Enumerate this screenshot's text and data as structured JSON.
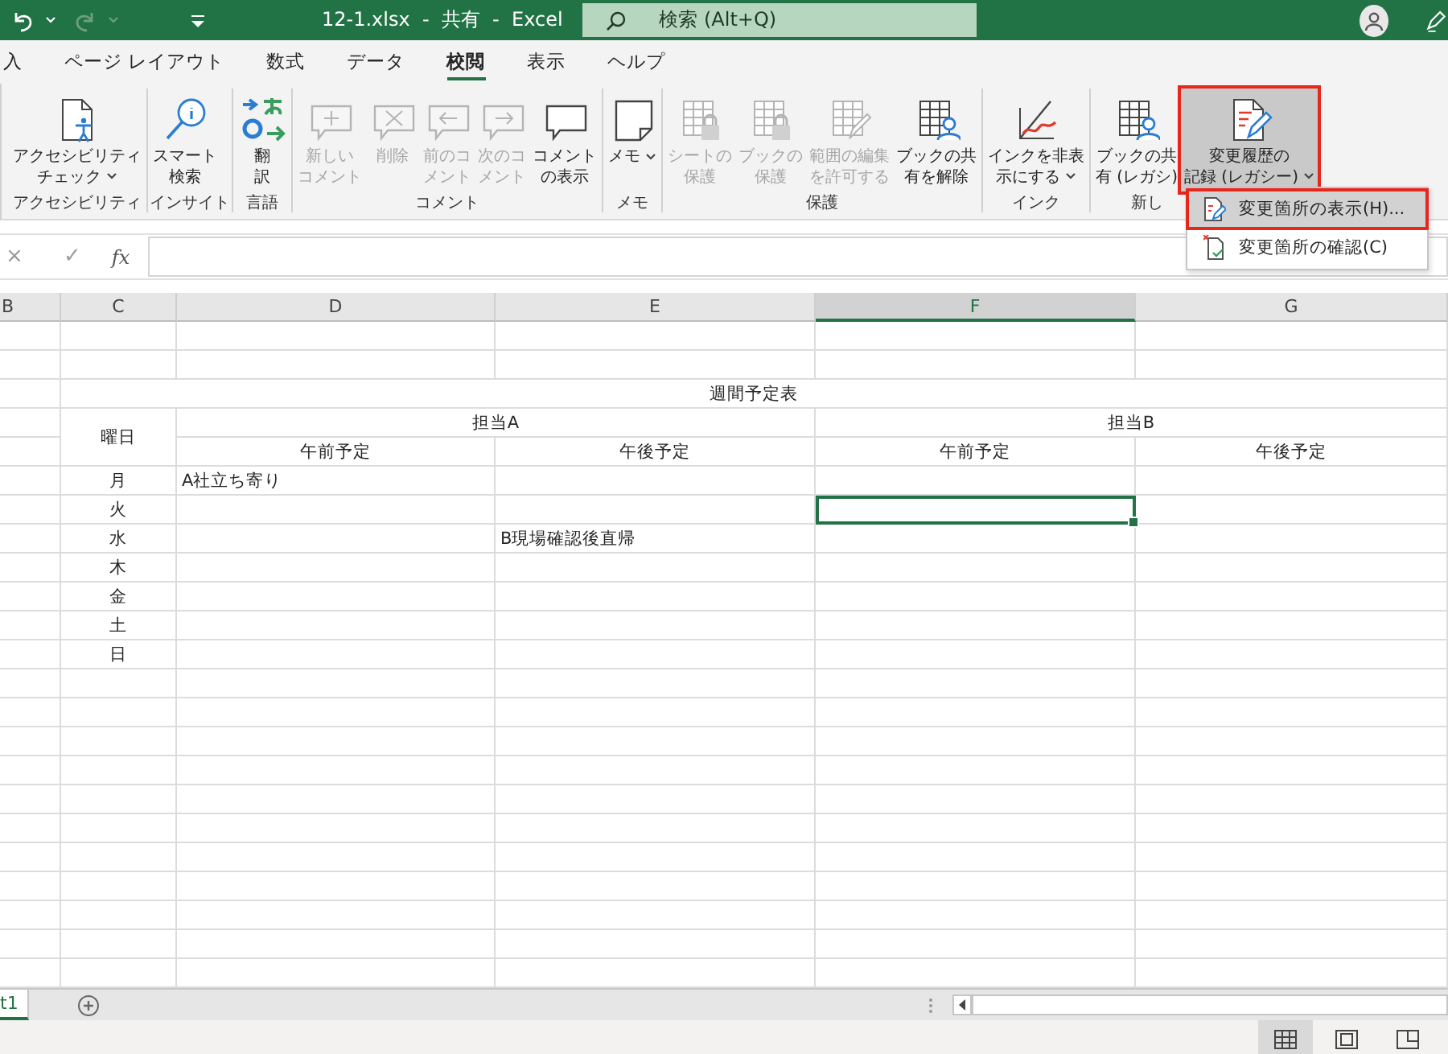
{
  "title_bar": {
    "quick_access": [
      {
        "kind": "undo",
        "disabled": false
      },
      {
        "kind": "redo",
        "disabled": true
      }
    ],
    "title": "12-1.xlsx  -  共有  -  Excel",
    "search": {
      "placeholder": "検索 (Alt+Q)"
    }
  },
  "ribbon_tabs": [
    {
      "label": "入",
      "selected": false
    },
    {
      "label": "ページ レイアウト",
      "selected": false
    },
    {
      "label": "数式",
      "selected": false
    },
    {
      "label": "データ",
      "selected": false
    },
    {
      "label": "校閲",
      "selected": true
    },
    {
      "label": "表示",
      "selected": false
    },
    {
      "label": "ヘルプ",
      "selected": false
    }
  ],
  "ribbon_groups": [
    {
      "label": "アクセシビリティ",
      "buttons": [
        {
          "kind": "accessibility",
          "label_lines": [
            "アクセシビリティ",
            "チェック"
          ],
          "dropdown": true,
          "disabled": false,
          "highlighted": false
        }
      ]
    },
    {
      "label": "インサイト",
      "buttons": [
        {
          "kind": "smart-lookup",
          "label_lines": [
            "スマート",
            "検索"
          ],
          "dropdown": false,
          "disabled": false,
          "highlighted": false
        }
      ]
    },
    {
      "label": "言語",
      "buttons": [
        {
          "kind": "translate",
          "label_lines": [
            "翻",
            "訳"
          ],
          "dropdown": false,
          "disabled": false,
          "highlighted": false
        }
      ]
    },
    {
      "label": "コメント",
      "buttons": [
        {
          "kind": "comment-new",
          "label_lines": [
            "新しい",
            "コメント"
          ],
          "dropdown": false,
          "disabled": true,
          "highlighted": false
        },
        {
          "kind": "comment-delete",
          "label_lines": [
            "削除"
          ],
          "dropdown": false,
          "disabled": true,
          "highlighted": false
        },
        {
          "kind": "comment-prev",
          "label_lines": [
            "前のコ",
            "メント"
          ],
          "dropdown": false,
          "disabled": true,
          "highlighted": false
        },
        {
          "kind": "comment-next",
          "label_lines": [
            "次のコ",
            "メント"
          ],
          "dropdown": false,
          "disabled": true,
          "highlighted": false
        },
        {
          "kind": "comment-show",
          "label_lines": [
            "コメント",
            "の表示"
          ],
          "dropdown": false,
          "disabled": false,
          "highlighted": false
        }
      ]
    },
    {
      "label": "メモ",
      "buttons": [
        {
          "kind": "memo",
          "label_lines": [
            "メモ"
          ],
          "dropdown": true,
          "disabled": false,
          "highlighted": false
        }
      ]
    },
    {
      "label": "保護",
      "buttons": [
        {
          "kind": "grid-lock",
          "label_lines": [
            "シートの",
            "保護"
          ],
          "dropdown": false,
          "disabled": true,
          "highlighted": false
        },
        {
          "kind": "grid-lock",
          "label_lines": [
            "ブックの",
            "保護"
          ],
          "dropdown": false,
          "disabled": true,
          "highlighted": false
        },
        {
          "kind": "grid-pencil",
          "label_lines": [
            "範囲の編集",
            "を許可する"
          ],
          "dropdown": false,
          "disabled": true,
          "highlighted": false
        },
        {
          "kind": "grid-person",
          "label_lines": [
            "ブックの共",
            "有を解除"
          ],
          "dropdown": false,
          "disabled": false,
          "highlighted": false
        }
      ]
    },
    {
      "label": "インク",
      "buttons": [
        {
          "kind": "ink",
          "label_lines": [
            "インクを非表",
            "示にする"
          ],
          "dropdown": true,
          "disabled": false,
          "highlighted": false
        }
      ]
    },
    {
      "label": "新し",
      "buttons": [
        {
          "kind": "grid-person",
          "label_lines": [
            "ブックの共",
            "有 (レガシ)"
          ],
          "dropdown": false,
          "disabled": false,
          "highlighted": false
        },
        {
          "kind": "track-changes",
          "label_lines": [
            "変更履歴の",
            "記録 (レガシー)"
          ],
          "dropdown": true,
          "disabled": false,
          "highlighted": true
        }
      ]
    }
  ],
  "menu": {
    "items": [
      {
        "kind": "show-changes",
        "label": "変更箇所の表示(H)...",
        "highlighted": true
      },
      {
        "kind": "accept-changes",
        "label": "変更箇所の確認(C)",
        "highlighted": false
      }
    ]
  },
  "formula_bar": {
    "cancel": "×",
    "enter": "✓",
    "function": "fx"
  },
  "sheet": {
    "columns": [
      {
        "label": "B",
        "selected": false
      },
      {
        "label": "C",
        "selected": false
      },
      {
        "label": "D",
        "selected": false
      },
      {
        "label": "E",
        "selected": false
      },
      {
        "label": "F",
        "selected": true
      },
      {
        "label": "G",
        "selected": false
      }
    ],
    "rows": [
      {
        "kind": "blank",
        "selected": false
      },
      {
        "kind": "blank",
        "selected": false
      },
      {
        "kind": "title",
        "text": "週間予定表",
        "selected": false
      },
      {
        "kind": "group-header",
        "label": "曜日",
        "groups": [
          "担当A",
          "担当B"
        ],
        "selected": false
      },
      {
        "kind": "sub-header",
        "cells": [
          "午前予定",
          "午後予定",
          "午前予定",
          "午後予定"
        ],
        "selected": false
      },
      {
        "kind": "day",
        "day": "月",
        "cells": [
          "A社立ち寄り",
          null,
          null,
          null
        ],
        "selected": false
      },
      {
        "kind": "day",
        "day": "火",
        "cells": [
          null,
          null,
          null,
          null
        ],
        "selected": true
      },
      {
        "kind": "day",
        "day": "水",
        "cells": [
          null,
          "B現場確認後直帰",
          null,
          null
        ],
        "selected": false
      },
      {
        "kind": "day",
        "day": "木",
        "cells": [
          null,
          null,
          null,
          null
        ],
        "selected": false
      },
      {
        "kind": "day",
        "day": "金",
        "cells": [
          null,
          null,
          null,
          null
        ],
        "selected": false
      },
      {
        "kind": "day",
        "day": "土",
        "cells": [
          null,
          null,
          null,
          null
        ],
        "selected": false
      },
      {
        "kind": "day",
        "day": "日",
        "cells": [
          null,
          null,
          null,
          null
        ],
        "selected": false
      },
      {
        "kind": "blank",
        "selected": false
      },
      {
        "kind": "blank",
        "selected": false
      },
      {
        "kind": "blank",
        "selected": false
      },
      {
        "kind": "blank",
        "selected": false
      },
      {
        "kind": "blank",
        "selected": false
      },
      {
        "kind": "blank",
        "selected": false
      },
      {
        "kind": "blank",
        "selected": false
      },
      {
        "kind": "blank",
        "selected": false
      },
      {
        "kind": "blank",
        "selected": false
      },
      {
        "kind": "blank",
        "selected": false
      },
      {
        "kind": "blank",
        "selected": false
      }
    ]
  },
  "sheet_tabs": [
    {
      "label": "t1",
      "selected": true
    }
  ],
  "status_bar": {
    "views": [
      {
        "kind": "normal",
        "selected": true
      },
      {
        "kind": "page-layout",
        "selected": false
      },
      {
        "kind": "page-break",
        "selected": false
      }
    ]
  }
}
